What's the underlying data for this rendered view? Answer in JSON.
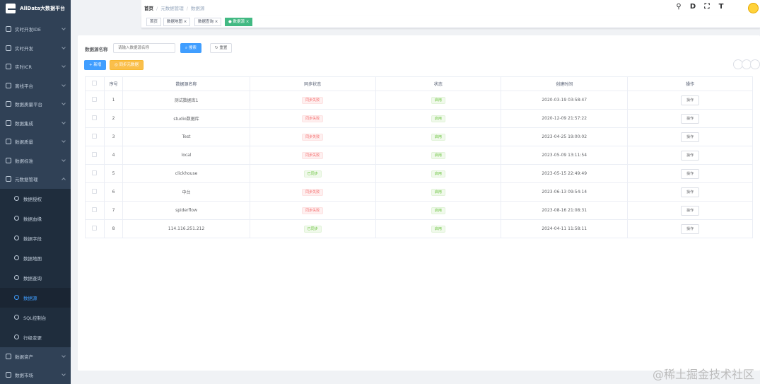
{
  "app": {
    "title": "AllData大数据平台"
  },
  "sidebar": {
    "items": [
      {
        "label": "实时开发IDE"
      },
      {
        "label": "实时开发"
      },
      {
        "label": "实时ICR"
      },
      {
        "label": "离线平台"
      },
      {
        "label": "数据质量平台"
      },
      {
        "label": "数据集成"
      },
      {
        "label": "数据质量"
      },
      {
        "label": "数据标准"
      },
      {
        "label": "元数据管理"
      }
    ],
    "subitems": [
      {
        "label": "数据授权"
      },
      {
        "label": "数据血缘"
      },
      {
        "label": "数据字段"
      },
      {
        "label": "数据地图"
      },
      {
        "label": "数据查询"
      },
      {
        "label": "数据源"
      },
      {
        "label": "SQL控制台"
      },
      {
        "label": "行级变更"
      }
    ],
    "after": [
      {
        "label": "数据资产"
      },
      {
        "label": "数据市场"
      }
    ]
  },
  "breadcrumb": {
    "home": "首页",
    "parent": "元数据管理",
    "current": "数据源"
  },
  "tags": [
    {
      "label": "首页"
    },
    {
      "label": "数据地图 ×"
    },
    {
      "label": "数据查询 ×"
    },
    {
      "label": "● 数据源 ×"
    }
  ],
  "search": {
    "label": "数据源名称",
    "placeholder": "请输入数据源名称",
    "search_btn": "搜索",
    "reset_btn": "重置"
  },
  "actions": {
    "add_btn": "+ 新增",
    "sync_btn": "◎ 同步元数据"
  },
  "table": {
    "headers": [
      "序号",
      "数据源名称",
      "同步状态",
      "状态",
      "创建时间",
      "操作"
    ],
    "rows": [
      {
        "index": "1",
        "name": "测试数据库1",
        "sync": "同步失败",
        "status": "启用",
        "created": "2020-03-19 03:58:47",
        "op": "操作"
      },
      {
        "index": "2",
        "name": "studio数据库",
        "sync": "同步失败",
        "status": "启用",
        "created": "2020-12-09 21:57:22",
        "op": "操作"
      },
      {
        "index": "3",
        "name": "Test",
        "sync": "同步失败",
        "status": "启用",
        "created": "2023-04-25 19:00:02",
        "op": "操作"
      },
      {
        "index": "4",
        "name": "local",
        "sync": "同步失败",
        "status": "启用",
        "created": "2023-05-09 13:11:54",
        "op": "操作"
      },
      {
        "index": "5",
        "name": "clickhouse",
        "sync": "已同步",
        "status": "启用",
        "created": "2023-05-15 22:49:49",
        "op": "操作"
      },
      {
        "index": "6",
        "name": "中台",
        "sync": "同步失败",
        "status": "启用",
        "created": "2023-06-13 09:54:14",
        "op": "操作"
      },
      {
        "index": "7",
        "name": "spiderflow",
        "sync": "同步失败",
        "status": "启用",
        "created": "2023-08-16 21:08:31",
        "op": "操作"
      },
      {
        "index": "8",
        "name": "114.116.251.212",
        "sync": "已同步",
        "status": "启用",
        "created": "2024-04-11 11:58:11",
        "op": "操作"
      }
    ]
  },
  "watermark": "@稀土掘金技术社区"
}
